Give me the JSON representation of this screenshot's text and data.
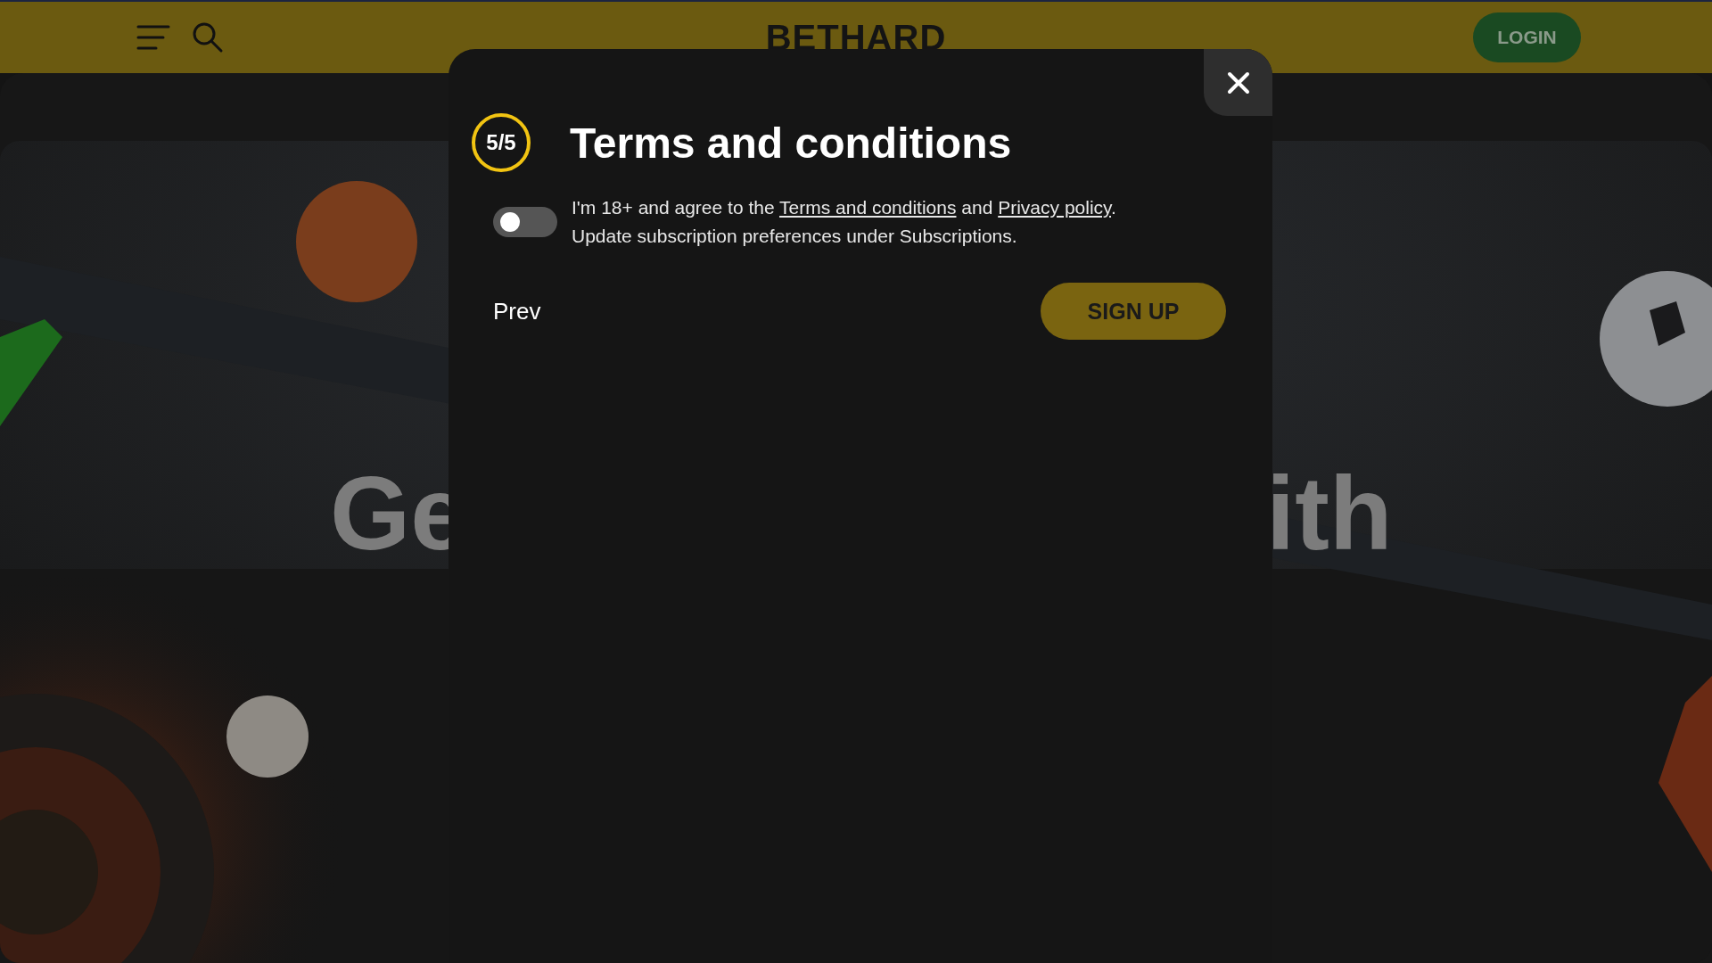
{
  "header": {
    "logo": "BETHARD",
    "login_button": "LOGIN"
  },
  "hero": {
    "heading_left": "Ge",
    "heading_right": "ith"
  },
  "modal": {
    "step": "5/5",
    "title": "Terms and conditions",
    "consent": {
      "on": false,
      "text": "I'm 18+ and agree to the ",
      "terms_link": "Terms and conditions",
      "middle": " and ",
      "privacy_link": "Privacy policy",
      "end": ".",
      "note": "Update subscription preferences under Subscriptions."
    },
    "prev_button": "Prev",
    "signup_button": "SIGN UP"
  }
}
